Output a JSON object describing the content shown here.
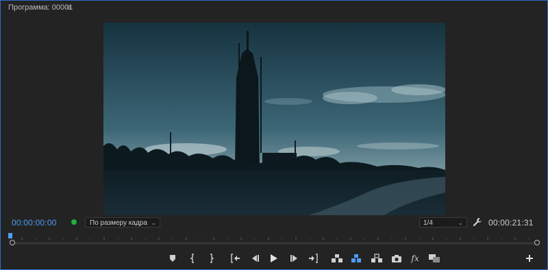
{
  "panel": {
    "title": "Программа: 00001",
    "menu_icon": "hamburger-menu-icon"
  },
  "controls": {
    "current_timecode": "00:00:00:00",
    "fit_dropdown": {
      "selected": "По размеру кадра"
    },
    "resolution_dropdown": {
      "selected": "1/4"
    },
    "duration_timecode": "00:00:21:31"
  },
  "colors": {
    "accent": "#4f9bf0",
    "status_dot": "#1fb03b",
    "panel_border": "#2d6fd1",
    "background": "#232323"
  },
  "transport": {
    "buttons": [
      {
        "icon": "add-marker-icon"
      },
      {
        "icon": "mark-in-icon"
      },
      {
        "icon": "mark-out-icon"
      },
      {
        "icon": "go-to-in-icon"
      },
      {
        "icon": "step-back-icon"
      },
      {
        "icon": "play-icon"
      },
      {
        "icon": "step-forward-icon"
      },
      {
        "icon": "go-to-out-icon"
      },
      {
        "icon": "lift-icon"
      },
      {
        "icon": "extract-icon"
      },
      {
        "icon": "insert-icon"
      },
      {
        "icon": "export-frame-icon"
      },
      {
        "icon": "fx-icon",
        "label": "fx"
      },
      {
        "icon": "comparison-view-icon"
      }
    ],
    "add_button_icon": "plus-icon"
  }
}
